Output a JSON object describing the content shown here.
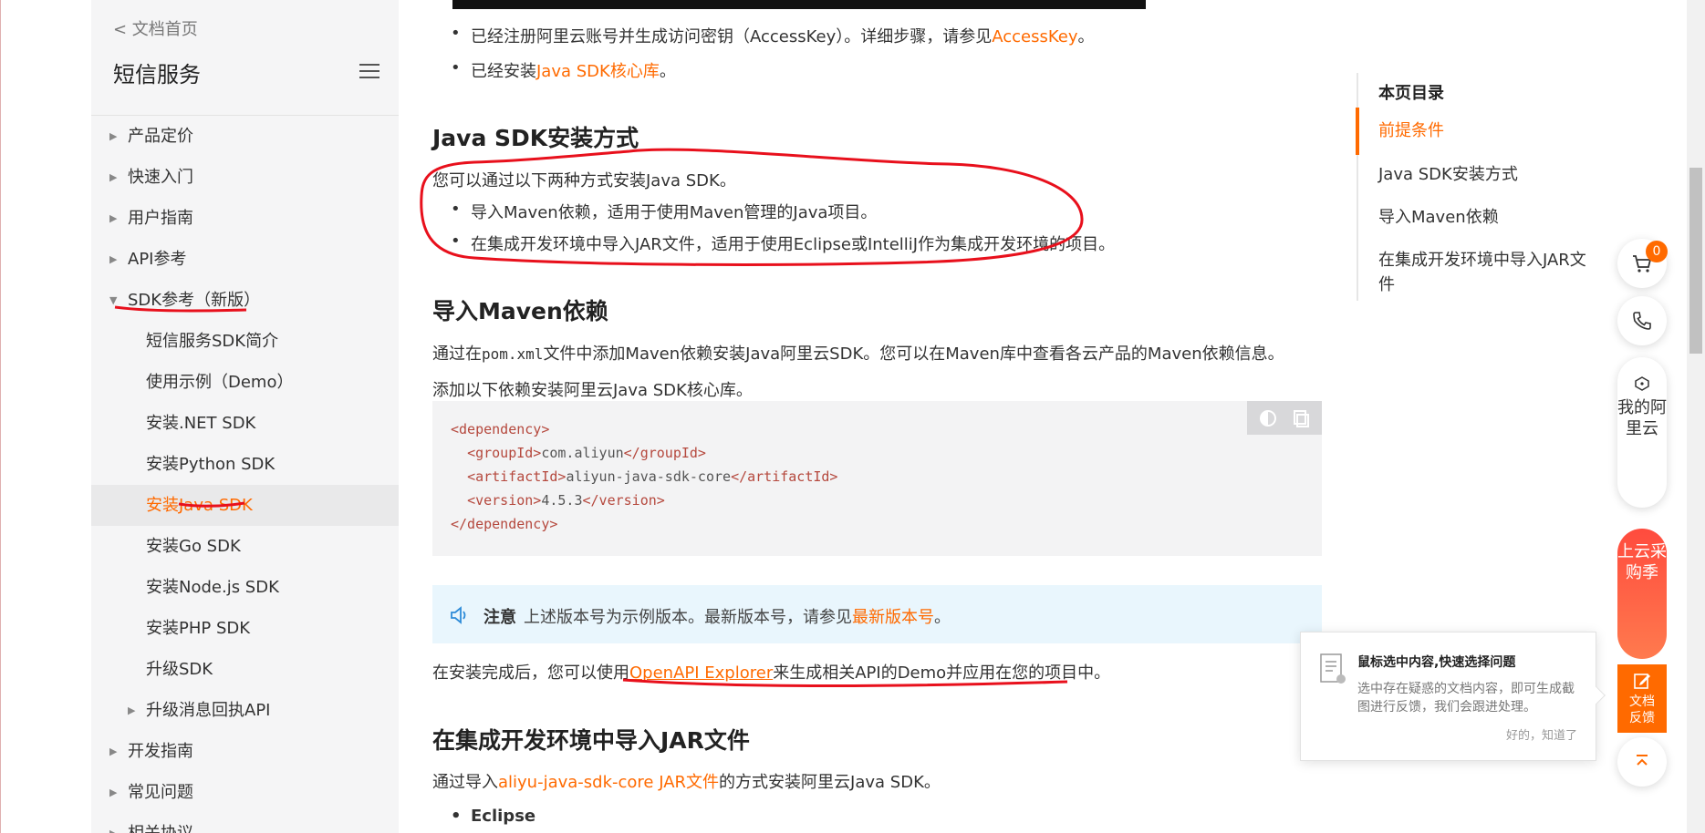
{
  "sidebar": {
    "back_label": "< 文档首页",
    "title": "短信服务",
    "items": [
      {
        "label": "产品定价"
      },
      {
        "label": "快速入门"
      },
      {
        "label": "用户指南"
      },
      {
        "label": "API参考"
      },
      {
        "label": "SDK参考（新版）"
      },
      {
        "label": "短信服务SDK简介"
      },
      {
        "label": "使用示例（Demo）"
      },
      {
        "label": "安装.NET SDK"
      },
      {
        "label": "安装Python SDK"
      },
      {
        "label": "安装Java SDK"
      },
      {
        "label": "安装Go SDK"
      },
      {
        "label": "安装Node.js SDK"
      },
      {
        "label": "安装PHP SDK"
      },
      {
        "label": "升级SDK"
      },
      {
        "label": "升级消息回执API"
      },
      {
        "label": "开发指南"
      },
      {
        "label": "常见问题"
      },
      {
        "label": "相关协议"
      }
    ]
  },
  "content": {
    "prereq_1_text": "已经注册阿里云账号并生成访问密钥（AccessKey）。详细步骤，请参见",
    "prereq_1_link": "AccessKey",
    "prereq_1_end": "。",
    "prereq_2_text": "已经安装",
    "prereq_2_link": "Java SDK核心库",
    "prereq_2_end": "。",
    "install_heading": "Java SDK安装方式",
    "install_intro": "您可以通过以下两种方式安装Java SDK。",
    "install_opt_1": "导入Maven依赖，适用于使用Maven管理的Java项目。",
    "install_opt_2": "在集成开发环境中导入JAR文件，适用于使用Eclipse或IntelliJ作为集成开发环境的项目。",
    "maven_heading": "导入Maven依赖",
    "maven_p1_a": "通过在",
    "maven_p1_code": "pom.xml",
    "maven_p1_b": "文件中添加Maven依赖安装Java阿里云SDK。您可以在Maven库中查看各云产品的Maven依赖信息。",
    "maven_p2": "添加以下依赖安装阿里云Java SDK核心库。",
    "code": {
      "l1_open": "<dependency>",
      "l2_open": "<groupId>",
      "l2_val": "com.aliyun",
      "l2_close": "</groupId>",
      "l3_open": "<artifactId>",
      "l3_val": "aliyun-java-sdk-core",
      "l3_close": "</artifactId>",
      "l4_open": "<version>",
      "l4_val": "4.5.3",
      "l4_close": "</version>",
      "l5_close": "</dependency>"
    },
    "note_label": "注意",
    "note_text": "上述版本号为示例版本。最新版本号，请参见",
    "note_link": "最新版本号",
    "note_end": "。",
    "after_a": "在安装完成后，您可以使用",
    "after_link": "OpenAPI Explorer",
    "after_b": "来生成相关API的Demo并应用在您的项目中。",
    "jar_heading": "在集成开发环境中导入JAR文件",
    "jar_p_a": "通过导入",
    "jar_p_link": "aliyu-java-sdk-core JAR文件",
    "jar_p_b": "的方式安装阿里云Java SDK。",
    "eclipse_label": "Eclipse"
  },
  "toc": {
    "title": "本页目录",
    "items": [
      {
        "label": "前提条件"
      },
      {
        "label": "Java SDK安装方式"
      },
      {
        "label": "导入Maven依赖"
      },
      {
        "label": "在集成开发环境中导入JAR文件"
      }
    ]
  },
  "float": {
    "cart_count": "0",
    "my_aliyun": "我的阿里云",
    "promo": "上云采购季",
    "feedback": "文档反馈"
  },
  "popup": {
    "title": "鼠标选中内容,快速选择问题",
    "desc": "选中存在疑惑的文档内容，即可生成截图进行反馈，我们会跟进处理。",
    "ok": "好的，知道了"
  },
  "colors": {
    "accent": "#ff6a00",
    "annotation": "#e8101c"
  }
}
